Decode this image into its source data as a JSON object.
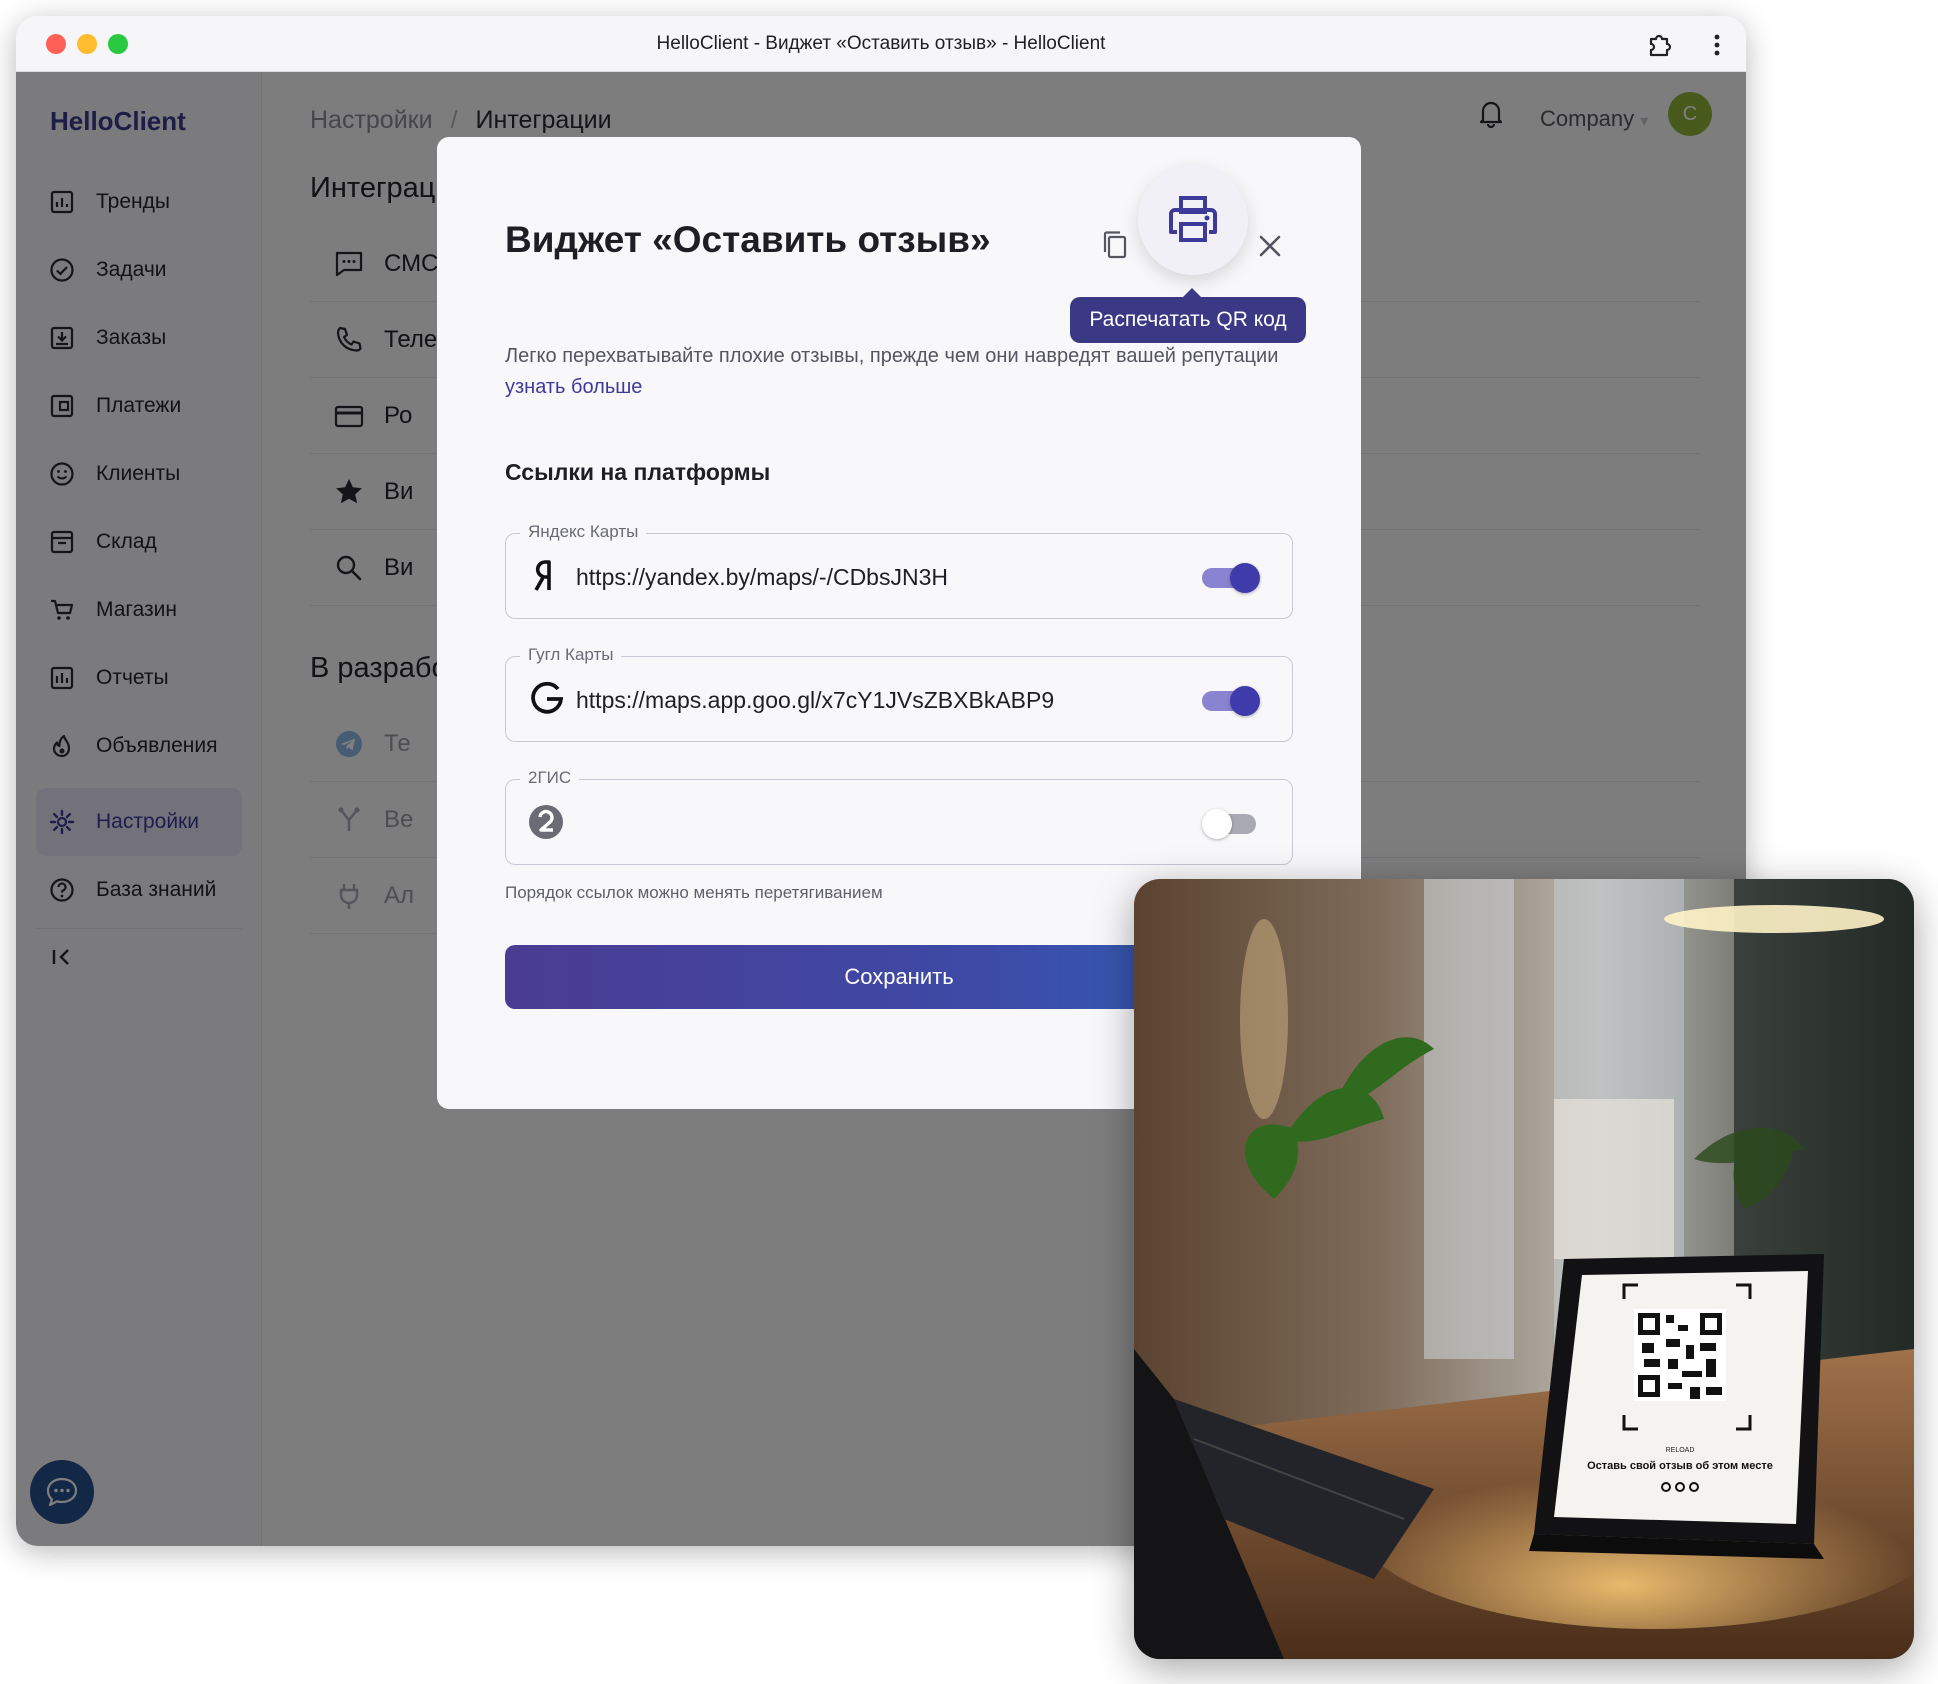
{
  "window": {
    "title": "HelloClient - Виджет «Оставить отзыв» - HelloClient"
  },
  "sidebar": {
    "brand": "HelloClient",
    "items": [
      {
        "label": "Тренды",
        "icon": "chart-icon"
      },
      {
        "label": "Задачи",
        "icon": "check-circle-icon"
      },
      {
        "label": "Заказы",
        "icon": "inbox-download-icon"
      },
      {
        "label": "Платежи",
        "icon": "wallet-icon"
      },
      {
        "label": "Клиенты",
        "icon": "smiley-icon"
      },
      {
        "label": "Склад",
        "icon": "storage-box-icon"
      },
      {
        "label": "Магазин",
        "icon": "cart-icon"
      },
      {
        "label": "Отчеты",
        "icon": "report-icon"
      },
      {
        "label": "Объявления",
        "icon": "flame-icon"
      },
      {
        "label": "Настройки",
        "icon": "gear-icon",
        "active": true
      },
      {
        "label": "База знаний",
        "icon": "help-circle-icon"
      }
    ]
  },
  "header": {
    "breadcrumb": [
      "Настройки",
      "Интеграции"
    ],
    "company": "Company",
    "avatar_initial": "C"
  },
  "main": {
    "section1": "Интеграции",
    "rows1": [
      "СМС",
      "Телефония",
      "Ро",
      "Ви",
      "Ви"
    ],
    "section2": "В разработке",
    "rows2": [
      "Те",
      "Ве",
      "Ал"
    ]
  },
  "modal": {
    "title": "Виджет «Оставить отзыв»",
    "tooltip": "Распечатать QR код",
    "description": "Легко перехватывайте плохие отзывы, прежде чем они навредят вашей репутации",
    "learn_more": "узнать больше",
    "subhead": "Ссылки на платформы",
    "fields": [
      {
        "label": "Яндекс Карты",
        "value": "https://yandex.by/maps/-/CDbsJN3H",
        "enabled": true,
        "icon": "yandex-logo-icon"
      },
      {
        "label": "Гугл Карты",
        "value": "https://maps.app.goo.gl/x7cY1JVsZBXBkABP9",
        "enabled": true,
        "icon": "google-logo-icon"
      },
      {
        "label": "2ГИС",
        "value": "",
        "enabled": false,
        "icon": "2gis-logo-icon"
      }
    ],
    "hint": "Порядок ссылок можно менять перетягиванием",
    "save": "Сохранить"
  },
  "photo": {
    "sign_brand": "RELOAD",
    "sign_text": "Оставь свой отзыв об этом месте"
  },
  "colors": {
    "accent": "#3d3a9a",
    "tooltip": "#3b3986",
    "avatar": "#8fb236"
  }
}
